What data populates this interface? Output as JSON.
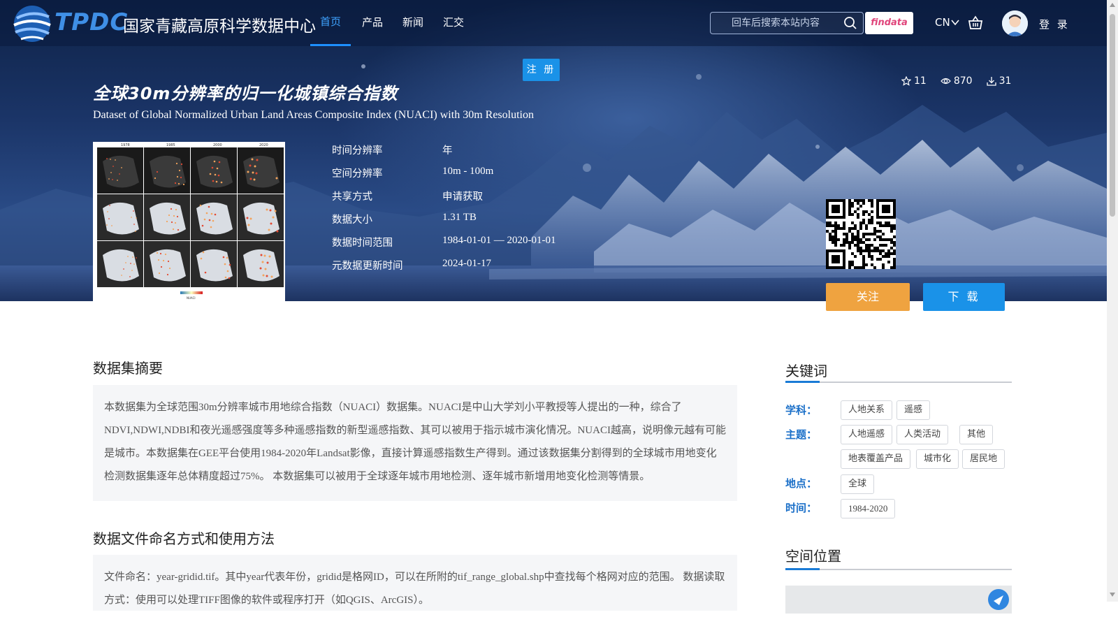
{
  "brand": {
    "logo_text": "TPDC",
    "name": "国家青藏高原科学数据中心"
  },
  "nav": {
    "items": [
      {
        "label": "首页",
        "active": true
      },
      {
        "label": "产品",
        "active": false
      },
      {
        "label": "新闻",
        "active": false
      },
      {
        "label": "汇交",
        "active": false
      }
    ]
  },
  "search": {
    "placeholder": "回车后搜索本站内容",
    "value": ""
  },
  "header_right": {
    "findata_label": "findata",
    "lang": "CN",
    "login_label": "登 录"
  },
  "register_label": "注 册",
  "dataset": {
    "title_cn": "全球30m分辨率的归一化城镇综合指数",
    "title_en": "Dataset of Global Normalized Urban Land Areas Composite Index (NUACI) with 30m Resolution",
    "stats": {
      "favorites": "11",
      "views": "870",
      "downloads": "31"
    },
    "meta": [
      {
        "key": "时间分辨率",
        "value": "年"
      },
      {
        "key": "空间分辨率",
        "value": "10m - 100m"
      },
      {
        "key": "共享方式",
        "value": "申请获取"
      },
      {
        "key": "数据大小",
        "value": "1.31 TB"
      },
      {
        "key": "数据时间范围",
        "value": "1984-01-01 — 2020-01-01"
      },
      {
        "key": "元数据更新时间",
        "value": "2024-01-17"
      }
    ],
    "thumbnail_year_labels": [
      "1978",
      "1985",
      "2000",
      "2020"
    ],
    "thumbnail_legend_label": "NUACI"
  },
  "actions": {
    "follow_label": "关注",
    "download_label": "下 载"
  },
  "sections": {
    "abstract_title": "数据集摘要",
    "abstract_text": "本数据集为全球范围30m分辨率城市用地综合指数（NUACI）数据集。NUACI是中山大学刘小平教授等人提出的一种，综合了NDVI,NDWI,NDBI和夜光遥感强度等多种遥感指数的新型遥感指数、其可以被用于指示城市演化情况。NUACI越高，说明像元越有可能是城市。本数据集在GEE平台使用1984-2020年Landsat影像，直接计算遥感指数生产得到。通过该数据集分割得到的全球城市用地变化检测数据集逐年总体精度超过75%。 本数据集可以被用于全球逐年城市用地检测、逐年城市新增用地变化检测等情景。",
    "naming_title": "数据文件命名方式和使用方法",
    "naming_text": "文件命名：year-gridid.tif。其中year代表年份，gridid是格网ID，可以在所附的tif_range_global.shp中查找每个格网对应的范围。 数据读取方式：使用可以处理TIFF图像的软件或程序打开（如QGIS、ArcGIS）。"
  },
  "keywords": {
    "title": "关键词",
    "groups": [
      {
        "label": "学科：",
        "tags": [
          "人地关系",
          "遥感"
        ]
      },
      {
        "label": "主题：",
        "tags": [
          "人地遥感",
          "人类活动",
          "其他",
          "地表覆盖产品",
          "城市化",
          "居民地"
        ]
      },
      {
        "label": "地点：",
        "tags": [
          "全球"
        ]
      },
      {
        "label": "时间：",
        "tags": [
          "1984-2020"
        ]
      }
    ]
  },
  "spatial_title": "空间位置",
  "colors": {
    "accent_blue": "#1a92e8",
    "follow_orange": "#efa340",
    "keyword_label_blue": "#1a6fc8",
    "nav_active": "#3ea3ff"
  }
}
